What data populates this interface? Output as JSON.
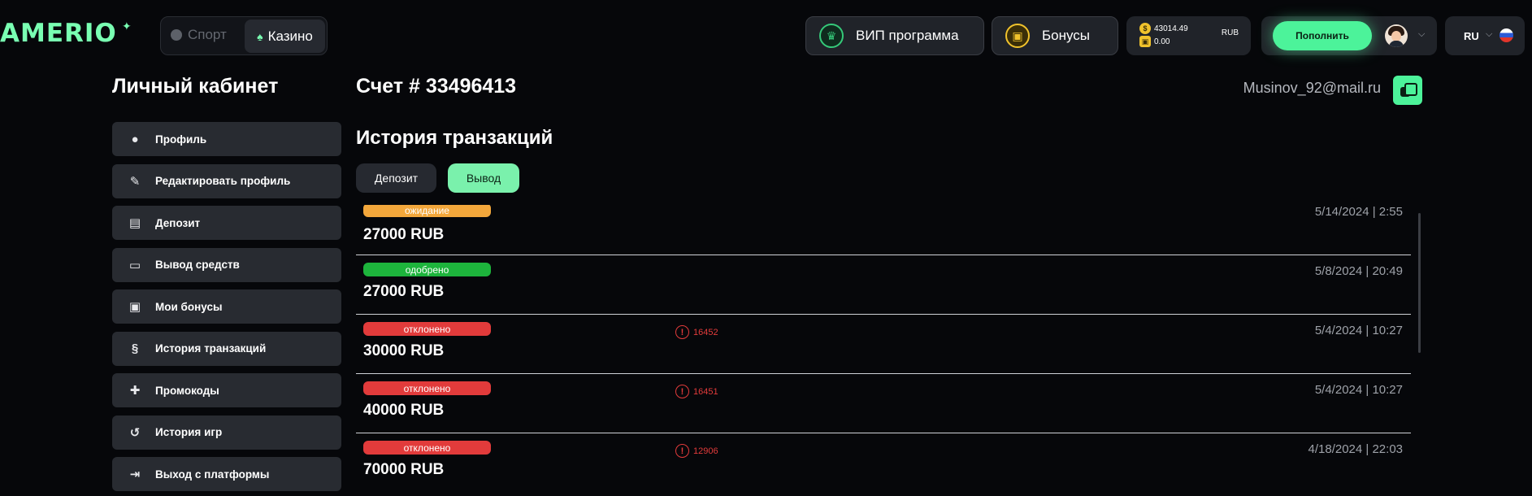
{
  "header": {
    "logo": "AMERIO",
    "mode_sport": "Спорт",
    "mode_casino": "Казино",
    "vip_label": "ВИП программа",
    "bonus_label": "Бонусы",
    "balance": {
      "main": "43014.49",
      "bonus": "0.00",
      "currency": "RUB"
    },
    "deposit_label": "Пополнить",
    "language": "RU"
  },
  "sidebar": {
    "title": "Личный кабинет",
    "items": [
      {
        "label": "Профиль",
        "icon": "user-icon"
      },
      {
        "label": "Редактировать профиль",
        "icon": "user-edit-icon"
      },
      {
        "label": "Депозит",
        "icon": "wallet-icon"
      },
      {
        "label": "Вывод средств",
        "icon": "card-withdraw-icon"
      },
      {
        "label": "Мои бонусы",
        "icon": "gift-icon"
      },
      {
        "label": "История транзакций",
        "icon": "receipt-icon"
      },
      {
        "label": "Промокоды",
        "icon": "puzzle-icon"
      },
      {
        "label": "История игр",
        "icon": "history-icon"
      },
      {
        "label": "Выход с платформы",
        "icon": "logout-icon"
      }
    ]
  },
  "account": {
    "title": "Счет # 33496413",
    "email": "Musinov_92@mail.ru"
  },
  "history": {
    "title": "История транзакций",
    "tab_deposit": "Депозит",
    "tab_withdraw": "Вывод",
    "transactions": [
      {
        "status": "ожидание",
        "amount": "27000 RUB",
        "date": "5/14/2024 | 2:55",
        "error_code": ""
      },
      {
        "status": "одобрено",
        "amount": "27000 RUB",
        "date": "5/8/2024 | 20:49",
        "error_code": ""
      },
      {
        "status": "отклонено",
        "amount": "30000 RUB",
        "date": "5/4/2024 | 10:27",
        "error_code": "16452"
      },
      {
        "status": "отклонено",
        "amount": "40000 RUB",
        "date": "5/4/2024 | 10:27",
        "error_code": "16451"
      },
      {
        "status": "отклонено",
        "amount": "70000 RUB",
        "date": "4/18/2024 | 22:03",
        "error_code": "12906"
      }
    ]
  },
  "colors": {
    "accent": "#4cf39a",
    "pending": "#f3a73b",
    "approved": "#1db43c",
    "rejected": "#e23b3b"
  }
}
